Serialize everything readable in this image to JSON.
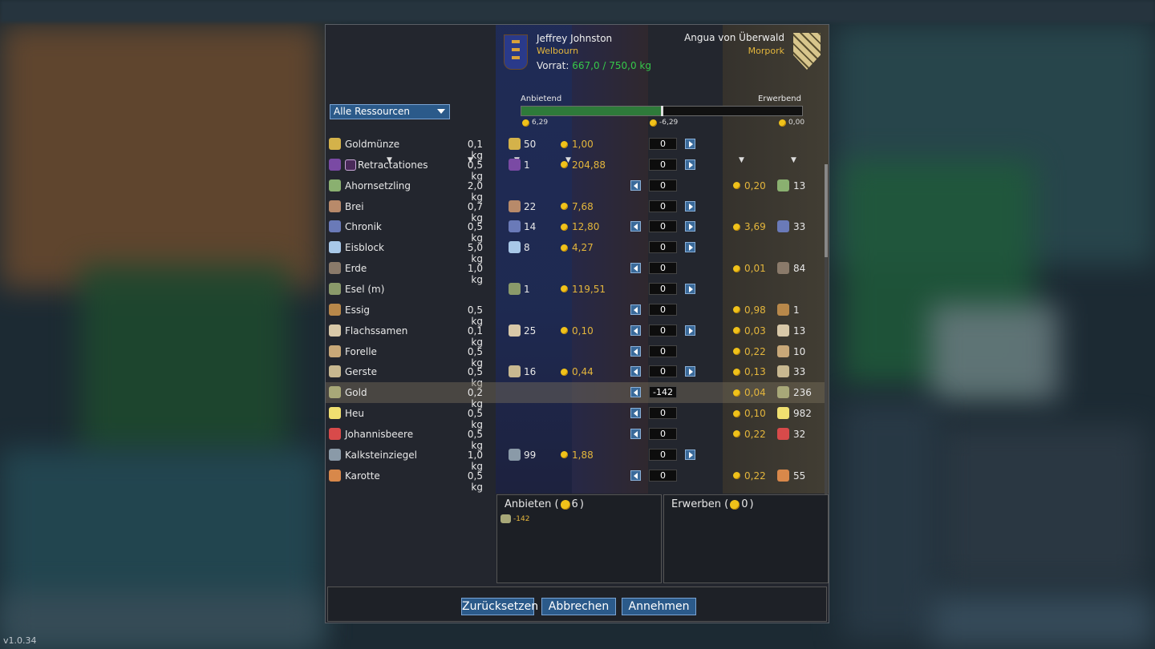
{
  "version": "v1.0.34",
  "trader_left": {
    "name": "Jeffrey Johnston",
    "town": "Welbourn",
    "stock_label": "Vorrat:",
    "stock_value": "667,0 / 750,0 kg"
  },
  "trader_right": {
    "name": "Angua von Überwald",
    "town": "Morpork"
  },
  "filter": {
    "selected": "Alle Ressourcen"
  },
  "balance": {
    "offering_label": "Anbietend",
    "acquiring_label": "Erwerbend",
    "left_value": "6,29",
    "mid_value": "-6,29",
    "right_value": "0,00",
    "slider_fraction": 0.5
  },
  "colors": {
    "gold": "#e4b63c",
    "green": "#36c84a",
    "button_blue": "#2b5a8a"
  },
  "rows": [
    {
      "icon": "gold-coin-icon",
      "color": "#d4b24a",
      "name": "Goldmünze",
      "weight": "0,1 kg",
      "offer_qty": "50",
      "price": "1,00",
      "qty": "0",
      "left_btn": false,
      "buy_price": "",
      "buy_qty": ""
    },
    {
      "icon": "book-icon",
      "color": "#7a4aa4",
      "name": "Retractationes",
      "weight": "0,5 kg",
      "offer_qty": "1",
      "price": "204,88",
      "qty": "0",
      "left_btn": false,
      "buy_price": "",
      "buy_qty": ""
    },
    {
      "icon": "sapling-icon",
      "color": "#8ab070",
      "name": "Ahornsetzling",
      "weight": "2,0 kg",
      "offer_qty": "",
      "price": "",
      "qty": "0",
      "left_btn": true,
      "buy_price": "0,20",
      "buy_qty": "13"
    },
    {
      "icon": "porridge-icon",
      "color": "#b88a6a",
      "name": "Brei",
      "weight": "0,7 kg",
      "offer_qty": "22",
      "price": "7,68",
      "qty": "0",
      "left_btn": false,
      "buy_price": "",
      "buy_qty": ""
    },
    {
      "icon": "chronicle-icon",
      "color": "#6a7ab8",
      "name": "Chronik",
      "weight": "0,5 kg",
      "offer_qty": "14",
      "price": "12,80",
      "qty": "0",
      "left_btn": true,
      "buy_price": "3,69",
      "buy_qty": "33"
    },
    {
      "icon": "ice-block-icon",
      "color": "#a8c8e8",
      "name": "Eisblock",
      "weight": "5,0 kg",
      "offer_qty": "8",
      "price": "4,27",
      "qty": "0",
      "left_btn": false,
      "buy_price": "",
      "buy_qty": ""
    },
    {
      "icon": "soil-icon",
      "color": "#8a7a6a",
      "name": "Erde",
      "weight": "1,0 kg",
      "offer_qty": "",
      "price": "",
      "qty": "0",
      "left_btn": true,
      "buy_price": "0,01",
      "buy_qty": "84"
    },
    {
      "icon": "donkey-icon",
      "color": "#8a9a6a",
      "name": "Esel (m)",
      "weight": "",
      "offer_qty": "1",
      "price": "119,51",
      "qty": "0",
      "left_btn": false,
      "buy_price": "",
      "buy_qty": ""
    },
    {
      "icon": "vinegar-icon",
      "color": "#b8884a",
      "name": "Essig",
      "weight": "0,5 kg",
      "offer_qty": "",
      "price": "",
      "qty": "0",
      "left_btn": true,
      "buy_price": "0,98",
      "buy_qty": "1"
    },
    {
      "icon": "flax-seed-icon",
      "color": "#d8c8a8",
      "name": "Flachssamen",
      "weight": "0,1 kg",
      "offer_qty": "25",
      "price": "0,10",
      "qty": "0",
      "left_btn": true,
      "buy_price": "0,03",
      "buy_qty": "13"
    },
    {
      "icon": "trout-icon",
      "color": "#c8a878",
      "name": "Forelle",
      "weight": "0,5 kg",
      "offer_qty": "",
      "price": "",
      "qty": "0",
      "left_btn": true,
      "buy_price": "0,22",
      "buy_qty": "10"
    },
    {
      "icon": "barley-icon",
      "color": "#c8b890",
      "name": "Gerste",
      "weight": "0,5 kg",
      "offer_qty": "16",
      "price": "0,44",
      "qty": "0",
      "left_btn": true,
      "buy_price": "0,13",
      "buy_qty": "33"
    },
    {
      "icon": "gold-ore-icon",
      "color": "#a8a878",
      "name": "Gold",
      "weight": "0,2 kg",
      "offer_qty": "",
      "price": "",
      "qty": "-142",
      "left_btn": true,
      "buy_price": "0,04",
      "buy_qty": "236",
      "selected": true
    },
    {
      "icon": "hay-icon",
      "color": "#f0e070",
      "name": "Heu",
      "weight": "0,5 kg",
      "offer_qty": "",
      "price": "",
      "qty": "0",
      "left_btn": true,
      "buy_price": "0,10",
      "buy_qty": "982"
    },
    {
      "icon": "currant-icon",
      "color": "#d84a4a",
      "name": "Johannisbeere",
      "weight": "0,5 kg",
      "offer_qty": "",
      "price": "",
      "qty": "0",
      "left_btn": true,
      "buy_price": "0,22",
      "buy_qty": "32"
    },
    {
      "icon": "limestone-brick-icon",
      "color": "#8a9aa8",
      "name": "Kalksteinziegel",
      "weight": "1,0 kg",
      "offer_qty": "99",
      "price": "1,88",
      "qty": "0",
      "left_btn": false,
      "buy_price": "",
      "buy_qty": ""
    },
    {
      "icon": "carrot-icon",
      "color": "#d8884a",
      "name": "Karotte",
      "weight": "0,5 kg",
      "offer_qty": "",
      "price": "",
      "qty": "0",
      "left_btn": true,
      "buy_price": "0,22",
      "buy_qty": "55"
    }
  ],
  "offer_panel": {
    "title": "Anbieten (",
    "coins": "6",
    "close": ")",
    "item_value": "-142"
  },
  "acquire_panel": {
    "title": "Erwerben (",
    "coins": "0",
    "close": ")"
  },
  "buttons": {
    "reset": "Zurücksetzen",
    "cancel": "Abbrechen",
    "accept": "Annehmen"
  }
}
